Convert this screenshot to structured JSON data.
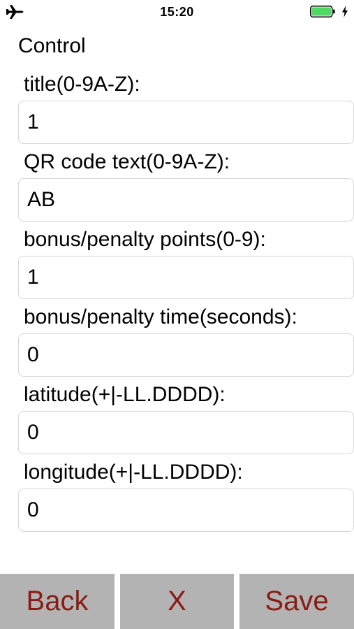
{
  "status_bar": {
    "time": "15:20",
    "airplane_icon": "airplane-icon",
    "battery_icon": "battery-icon",
    "charging_icon": "charging-bolt-icon",
    "battery_level": 1.0,
    "battery_color": "#4cd964"
  },
  "screen": {
    "title": "Control"
  },
  "fields": [
    {
      "label": "title(0-9A-Z):",
      "value": "1"
    },
    {
      "label": "QR code text(0-9A-Z):",
      "value": "AB"
    },
    {
      "label": "bonus/penalty points(0-9):",
      "value": "1"
    },
    {
      "label": "bonus/penalty time(seconds):",
      "value": "0"
    },
    {
      "label": "latitude(+|-LL.DDDD):",
      "value": "0"
    },
    {
      "label": "longitude(+|-LL.DDDD):",
      "value": "0"
    }
  ],
  "buttons": {
    "back": "Back",
    "cancel": "X",
    "save": "Save"
  },
  "colors": {
    "button_background": "#b3b3b3",
    "button_text": "#8a1a14",
    "input_border": "#d6d6d6"
  }
}
